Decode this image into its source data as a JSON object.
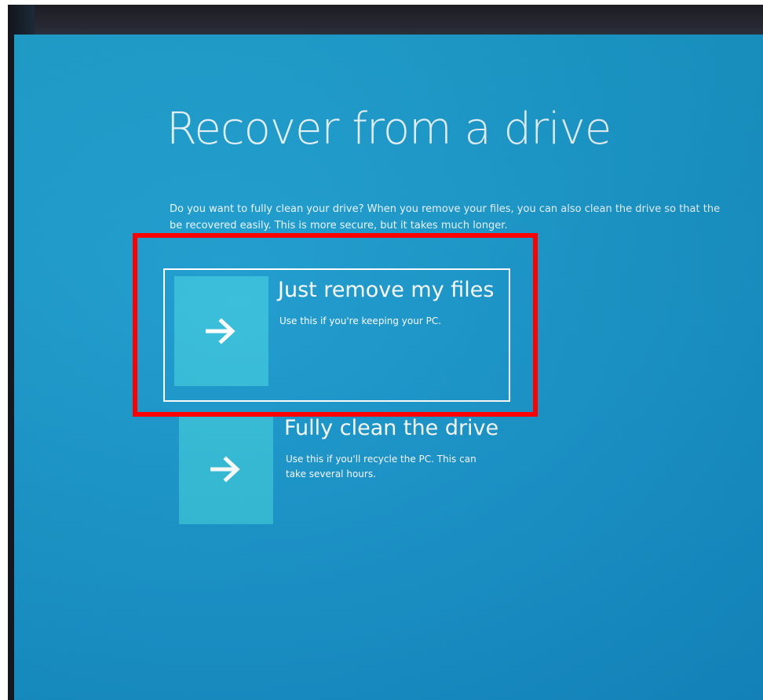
{
  "screen": {
    "title": "Recover from a drive",
    "description_line1": "Do you want to fully clean your drive? When you remove your files, you can also clean the drive so that the",
    "description_line2": "be recovered easily. This is more secure, but it takes much longer."
  },
  "options": [
    {
      "title": "Just remove my files",
      "description": "Use this if you're keeping your PC.",
      "icon": "arrow-right-icon",
      "selected": true
    },
    {
      "title": "Fully clean the drive",
      "description": "Use this if you'll recycle the PC. This can take several hours.",
      "icon": "arrow-right-icon",
      "selected": false
    }
  ],
  "colors": {
    "background": "#1596cb",
    "tile": "#2fbbd8",
    "text": "#ffffff",
    "highlight": "#ff0000"
  }
}
